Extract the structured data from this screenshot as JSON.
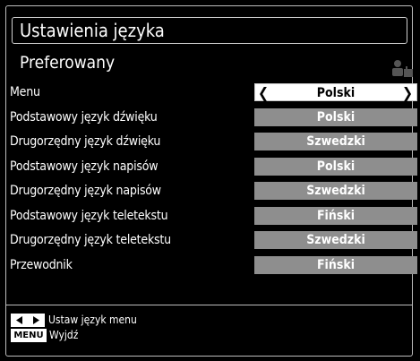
{
  "header": {
    "title": "Ustawienia języka",
    "section": "Preferowany"
  },
  "settings": [
    {
      "label": "Menu",
      "value": "Polski",
      "selected": true
    },
    {
      "label": "Podstawowy język dźwięku",
      "value": "Polski",
      "selected": false
    },
    {
      "label": "Drugorzędny język dźwięku",
      "value": "Szwedzki",
      "selected": false
    },
    {
      "label": "Podstawowy język napisów",
      "value": "Polski",
      "selected": false
    },
    {
      "label": "Drugorzędny język napisów",
      "value": "Szwedzki",
      "selected": false
    },
    {
      "label": "Podstawowy język teletekstu",
      "value": "Fiński",
      "selected": false
    },
    {
      "label": "Drugorzędny język teletekstu",
      "value": "Szwedzki",
      "selected": false
    },
    {
      "label": "Przewodnik",
      "value": "Fiński",
      "selected": false
    }
  ],
  "help": {
    "line1": "Ustaw język menu",
    "line2_key": "MENU",
    "line2": "Wyjdź"
  },
  "icons": {
    "corner": "person-settings-icon",
    "left_arrow": "arrow-left-icon",
    "right_arrow": "arrow-right-icon"
  },
  "colors": {
    "background": "#000000",
    "option_bg": "#8e8e8e",
    "selected_bg": "#ffffff"
  }
}
